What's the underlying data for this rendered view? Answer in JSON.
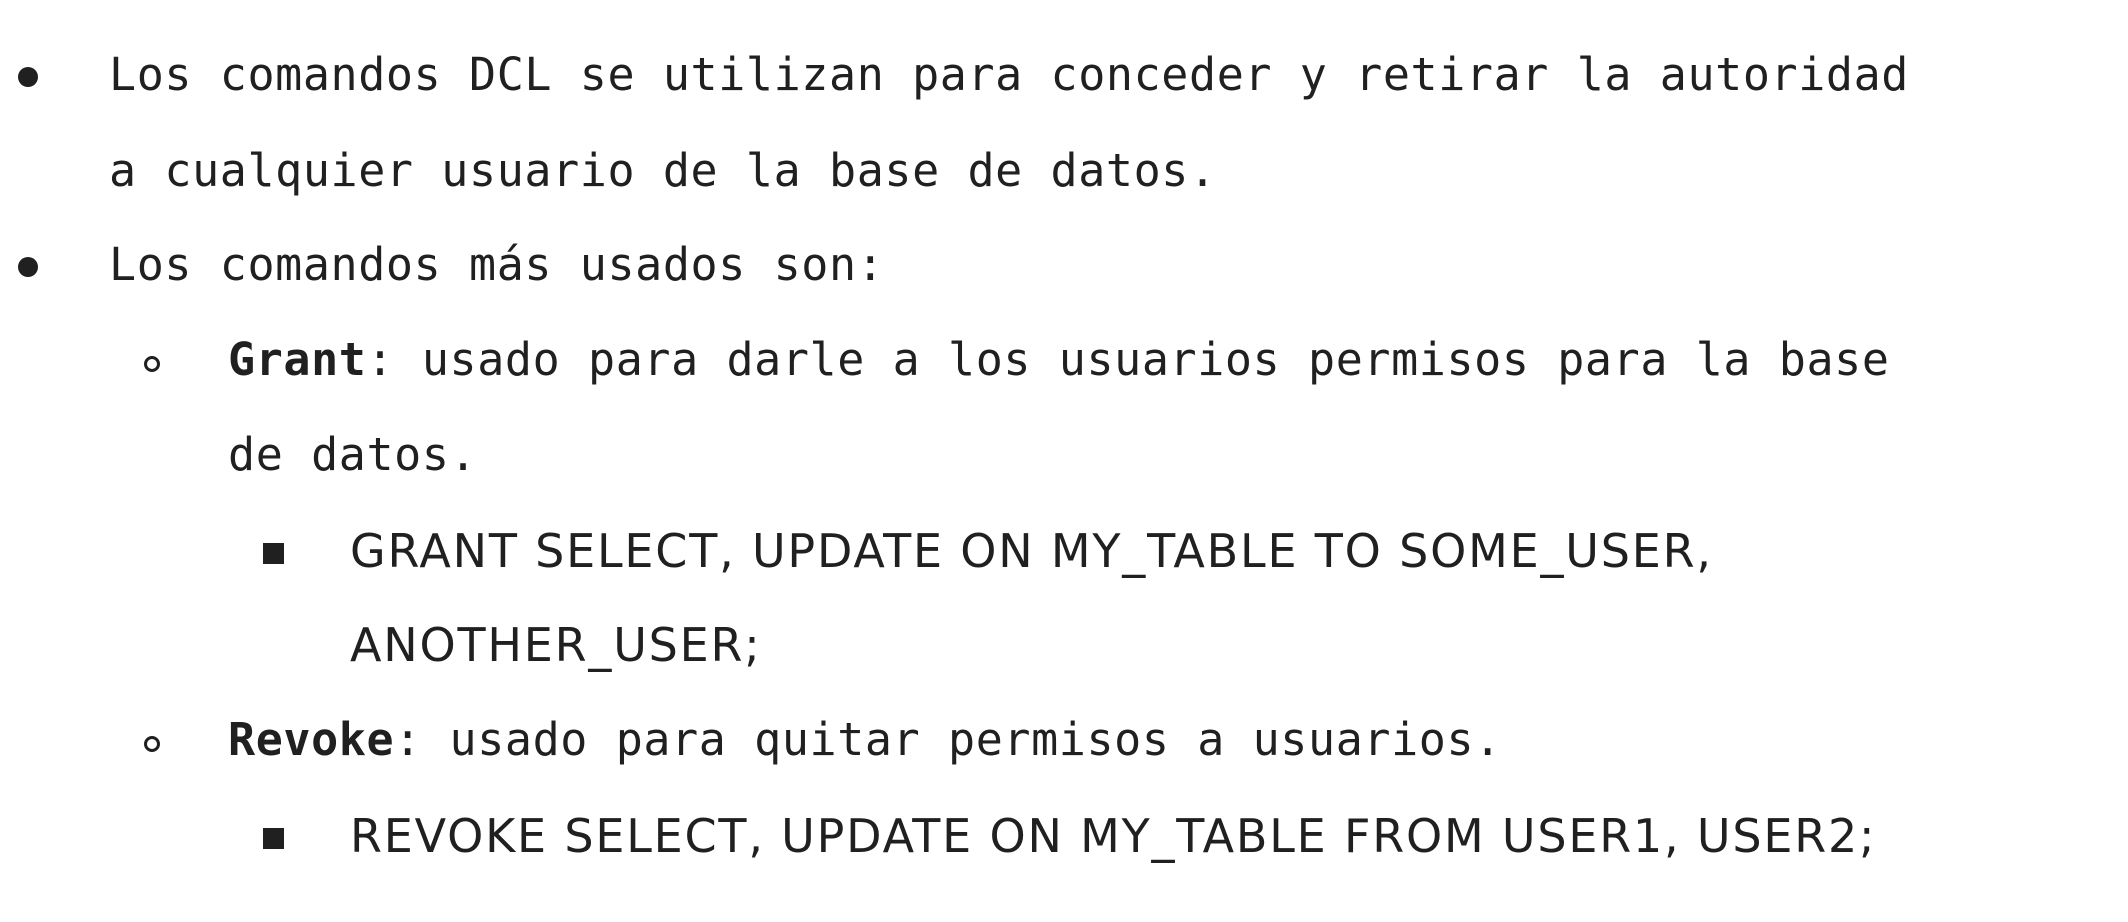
{
  "bullets": {
    "dcl_description": {
      "line1": "Los comandos DCL se utilizan para conceder y retirar la autoridad",
      "line2": "a cualquier usuario de la base de datos."
    },
    "common_commands": {
      "intro": "Los comandos más usados son:",
      "grant": {
        "term": "Grant",
        "desc_line1": ": usado para darle a los usuarios permisos para la base",
        "desc_line2": "de datos.",
        "example_line1": "GRANT SELECT, UPDATE ON MY_TABLE TO SOME_USER,",
        "example_line2": "ANOTHER_USER;"
      },
      "revoke": {
        "term": "Revoke",
        "desc": ": usado para quitar permisos a usuarios.",
        "example": "REVOKE SELECT, UPDATE ON MY_TABLE FROM USER1, USER2;"
      }
    }
  },
  "colors": {
    "text": "#202020",
    "background": "#ffffff"
  }
}
